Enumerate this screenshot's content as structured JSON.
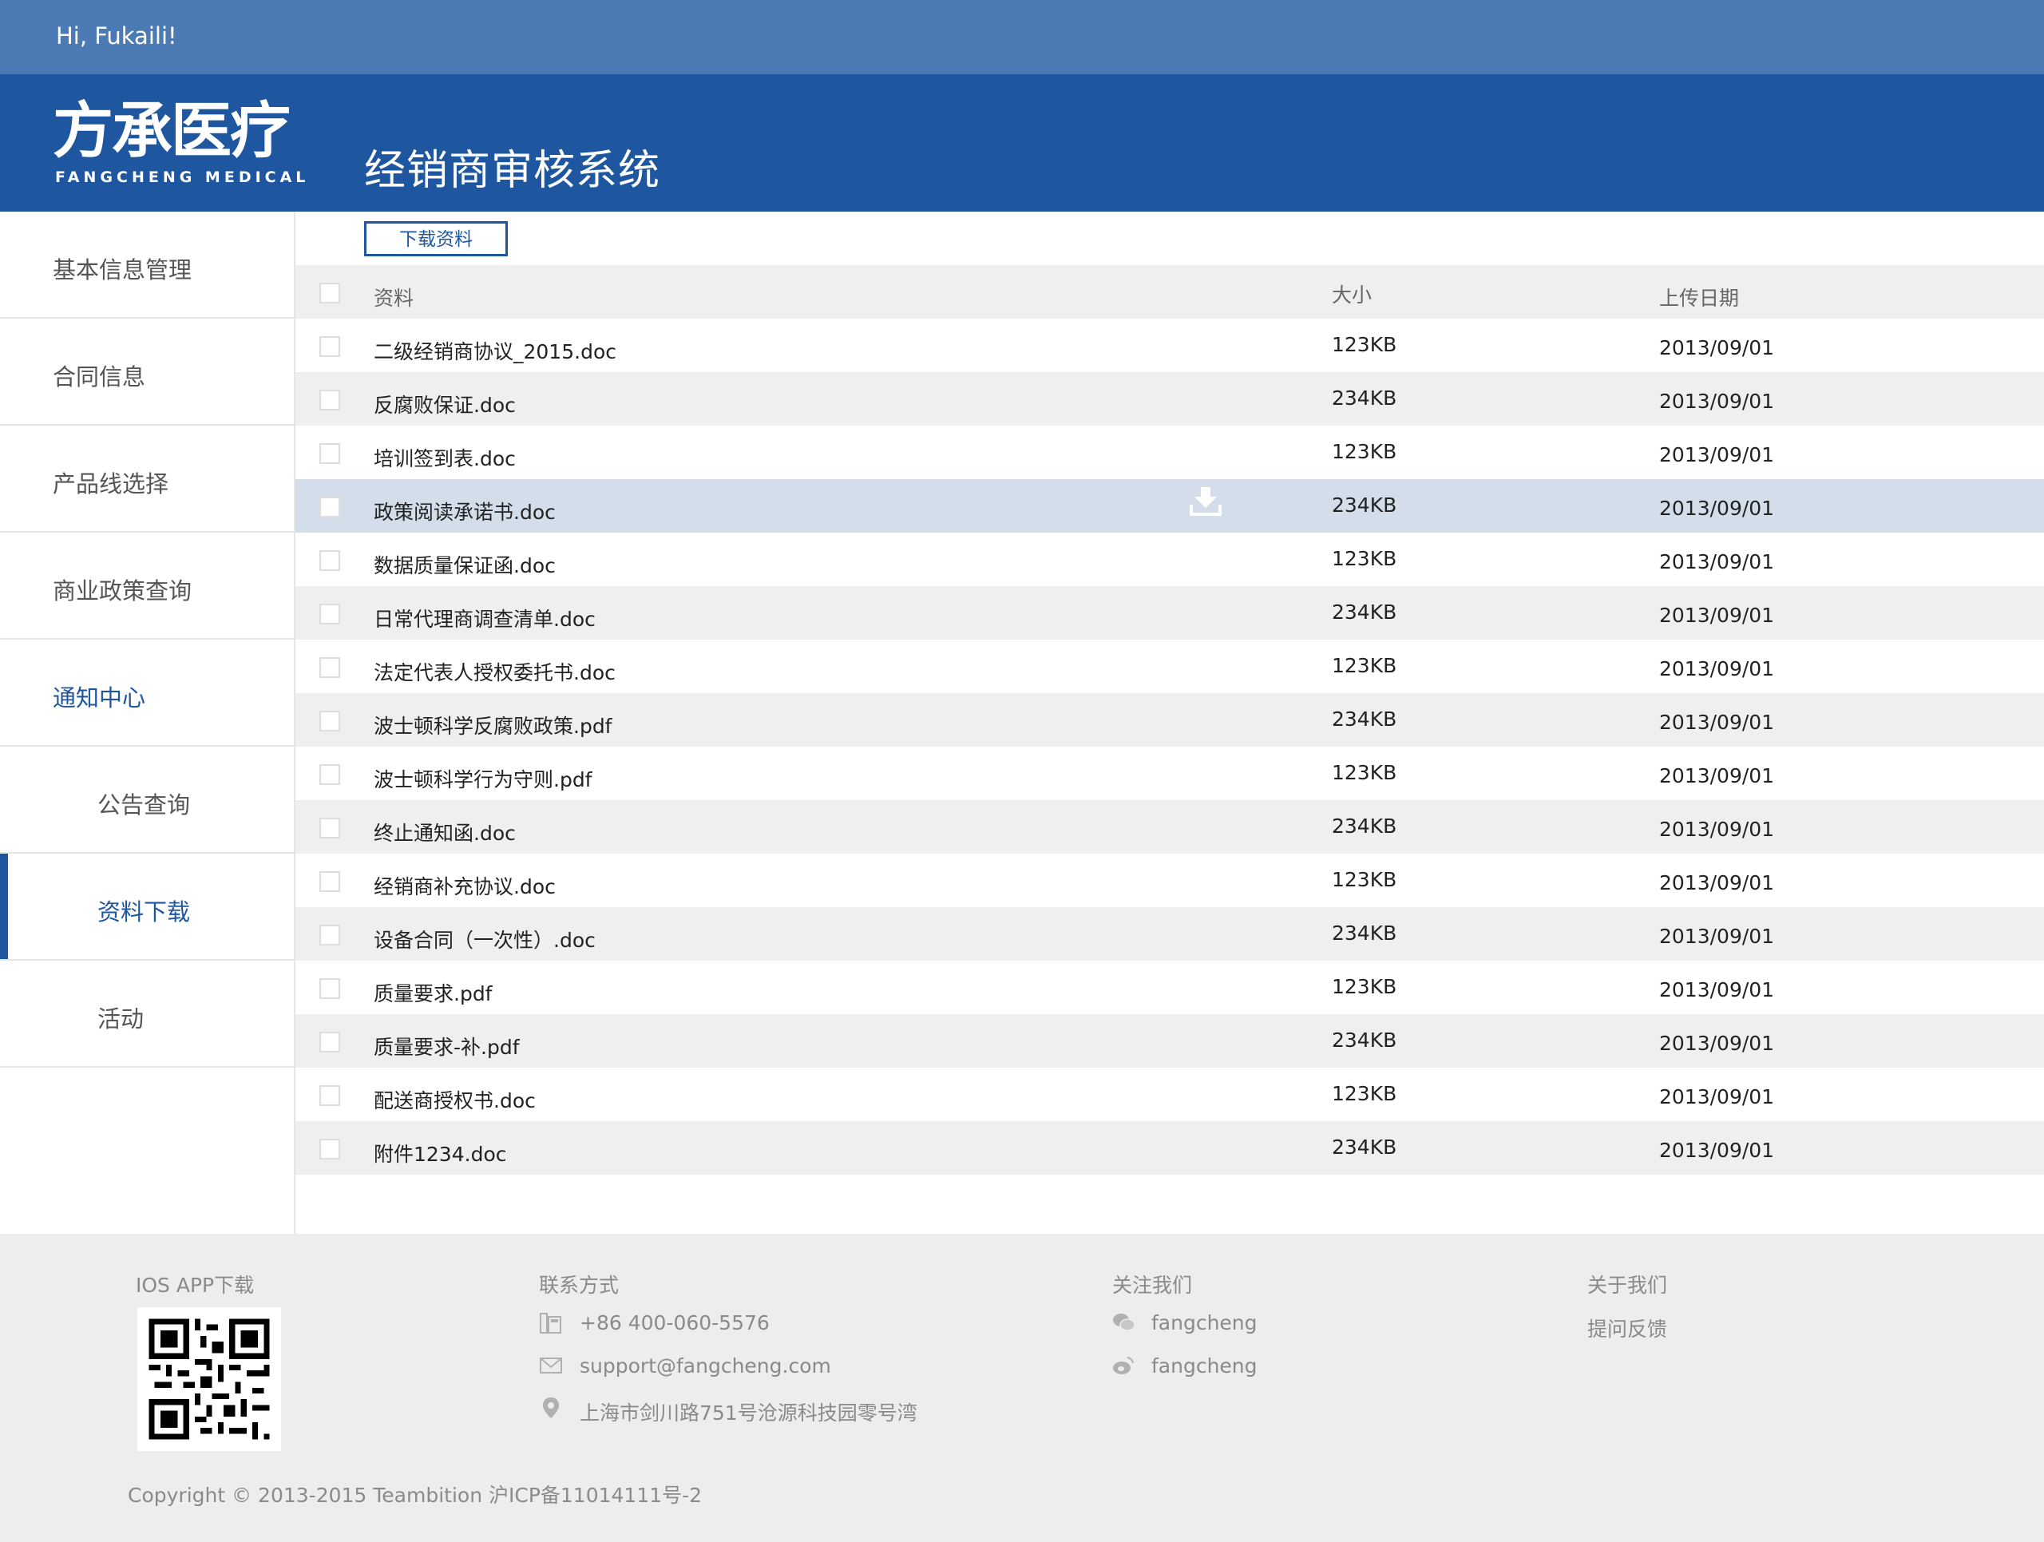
{
  "topbar": {
    "greeting": "Hi, Fukaili!"
  },
  "header": {
    "logo_cn": "方承医疗",
    "logo_en": "FANGCHENG  MEDICAL",
    "system_title": "经销商审核系统"
  },
  "sidebar": {
    "items": [
      {
        "label": "基本信息管理"
      },
      {
        "label": "合同信息"
      },
      {
        "label": "产品线选择"
      },
      {
        "label": "商业政策查询"
      },
      {
        "label": "通知中心"
      },
      {
        "label": "公告查询"
      },
      {
        "label": "资料下载"
      },
      {
        "label": "活动"
      }
    ]
  },
  "toolbar": {
    "download_label": "下载资料"
  },
  "table": {
    "headers": {
      "name": "资料",
      "size": "大小",
      "date": "上传日期"
    },
    "rows": [
      {
        "name": "二级经销商协议_2015.doc",
        "size": "123KB",
        "date": "2013/09/01"
      },
      {
        "name": "反腐败保证.doc",
        "size": "234KB",
        "date": "2013/09/01"
      },
      {
        "name": "培训签到表.doc",
        "size": "123KB",
        "date": "2013/09/01"
      },
      {
        "name": "政策阅读承诺书.doc",
        "size": "234KB",
        "date": "2013/09/01"
      },
      {
        "name": "数据质量保证函.doc",
        "size": "123KB",
        "date": "2013/09/01"
      },
      {
        "name": "日常代理商调查清单.doc",
        "size": "234KB",
        "date": "2013/09/01"
      },
      {
        "name": "法定代表人授权委托书.doc",
        "size": "123KB",
        "date": "2013/09/01"
      },
      {
        "name": "波士顿科学反腐败政策.pdf",
        "size": "234KB",
        "date": "2013/09/01"
      },
      {
        "name": "波士顿科学行为守则.pdf",
        "size": "123KB",
        "date": "2013/09/01"
      },
      {
        "name": "终止通知函.doc",
        "size": "234KB",
        "date": "2013/09/01"
      },
      {
        "name": "经销商补充协议.doc",
        "size": "123KB",
        "date": "2013/09/01"
      },
      {
        "name": "设备合同（一次性）.doc",
        "size": "234KB",
        "date": "2013/09/01"
      },
      {
        "name": "质量要求.pdf",
        "size": "123KB",
        "date": "2013/09/01"
      },
      {
        "name": "质量要求-补.pdf",
        "size": "234KB",
        "date": "2013/09/01"
      },
      {
        "name": "配送商授权书.doc",
        "size": "123KB",
        "date": "2013/09/01"
      },
      {
        "name": "附件1234.doc",
        "size": "234KB",
        "date": "2013/09/01"
      }
    ]
  },
  "footer": {
    "app_title": "IOS APP下载",
    "contact_title": "联系方式",
    "phone": "+86 400-060-5576",
    "email": "support@fangcheng.com",
    "address": "上海市剑川路751号沧源科技园零号湾",
    "follow_title": "关注我们",
    "wechat": "fangcheng",
    "weibo": "fangcheng",
    "about_title": "关于我们",
    "feedback": "提问反馈",
    "copyright": "Copyright © 2013-2015 Teambition 沪ICP备11014111号-2"
  },
  "colors": {
    "brand_dark": "#1e57a0",
    "brand_light": "#4b7ab5",
    "row_alt": "#efefef",
    "row_highlight": "#d3deea"
  }
}
